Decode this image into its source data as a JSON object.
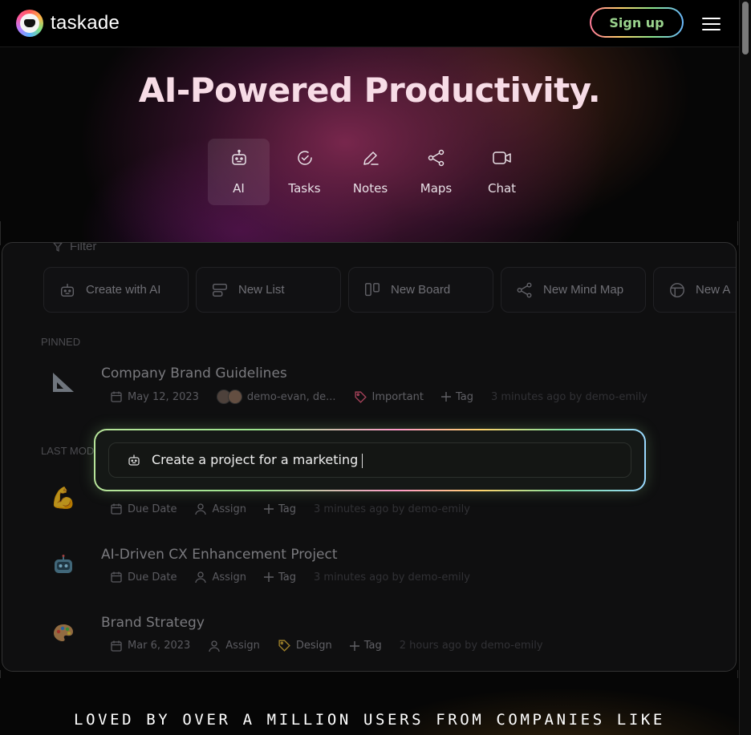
{
  "header": {
    "brand": "taskade",
    "signup_label": "Sign up"
  },
  "hero": {
    "title": "AI-Powered Productivity.",
    "tabs": [
      {
        "label": "AI",
        "icon": "robot-icon",
        "active": true
      },
      {
        "label": "Tasks",
        "icon": "check-circle-icon",
        "active": false
      },
      {
        "label": "Notes",
        "icon": "pen-icon",
        "active": false
      },
      {
        "label": "Maps",
        "icon": "mind-map-icon",
        "active": false
      },
      {
        "label": "Chat",
        "icon": "video-icon",
        "active": false
      }
    ]
  },
  "app": {
    "filter_label": "Filter",
    "actions": [
      {
        "label": "Create with AI",
        "icon": "robot-icon"
      },
      {
        "label": "New List",
        "icon": "list-icon"
      },
      {
        "label": "New Board",
        "icon": "board-icon"
      },
      {
        "label": "New Mind Map",
        "icon": "mind-map-icon"
      },
      {
        "label": "New A",
        "icon": "grid-icon"
      }
    ],
    "pinned_label": "PINNED",
    "last_modified_label": "LAST MOD",
    "items": [
      {
        "title": "Company Brand Guidelines",
        "icon": "triangle-ruler-icon",
        "date": "May 12, 2023",
        "members": "demo-evan, de...",
        "tag": "Important",
        "tag_color": "#e05a7a",
        "add_tag": "Tag",
        "updated": "3 minutes ago by demo-emily"
      },
      {
        "title": "",
        "icon": "flexed-biceps-icon",
        "date": "Due Date",
        "assign": "Assign",
        "add_tag": "Tag",
        "updated": "3 minutes ago by demo-emily"
      },
      {
        "title": "AI-Driven CX Enhancement Project",
        "icon": "robot-face-icon",
        "date": "Due Date",
        "assign": "Assign",
        "add_tag": "Tag",
        "updated": "3 minutes ago by demo-emily"
      },
      {
        "title": "Brand Strategy",
        "icon": "palette-icon",
        "date": "Mar 6, 2023",
        "assign": "Assign",
        "tag": "Design",
        "tag_color": "#d9b13a",
        "add_tag": "Tag",
        "updated": "2 hours ago by demo-emily"
      }
    ]
  },
  "prompt": {
    "text": "Create a project for a marketing"
  },
  "footer": {
    "loved_text": "LOVED BY OVER A MILLION USERS FROM COMPANIES LIKE"
  }
}
